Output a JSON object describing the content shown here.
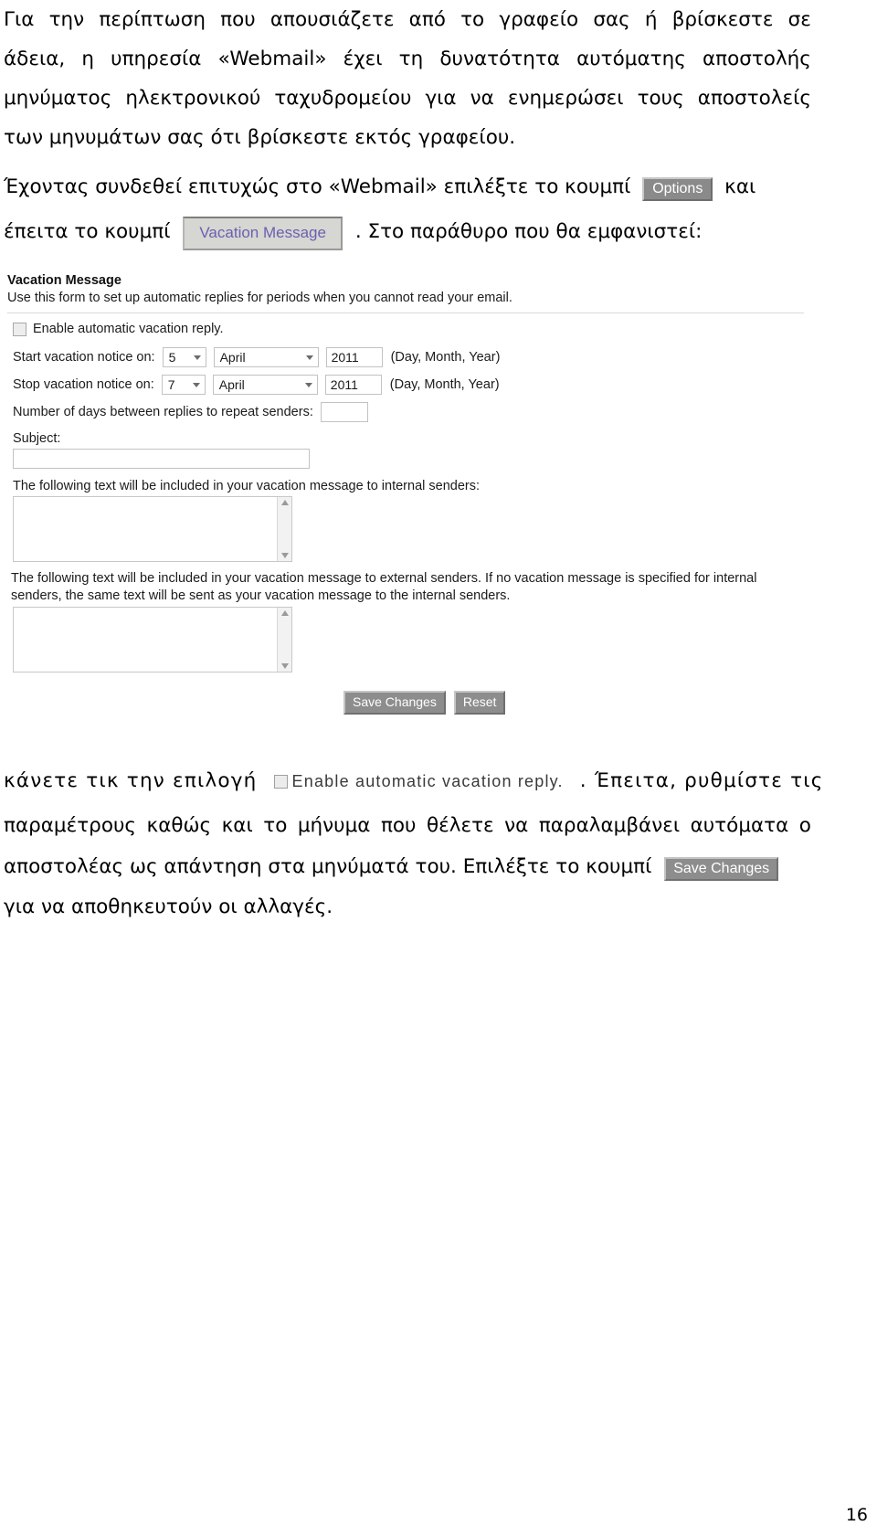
{
  "document": {
    "page_number": "16"
  },
  "intro_paragraph": {
    "lines": [
      [
        "Για",
        "την",
        "περίπτωση",
        "που",
        "απουσιάζετε",
        "από",
        "το",
        "γραφείο",
        "σας",
        "ή",
        "βρίσκεστε",
        "σε"
      ],
      [
        "άδεια,",
        "η",
        "υπηρεσία",
        "«Webmail»",
        "έχει",
        "τη",
        "δυνατότητα",
        "αυτόματης",
        "αποστολής"
      ],
      [
        "μηνύματος",
        "ηλεκτρονικού",
        "ταχυδρομείου",
        "για",
        "να",
        "ενημερώσει",
        "τους",
        "αποστολείς"
      ]
    ],
    "last_line": "των μηνυμάτων σας ότι βρίσκεστε εκτός γραφείου."
  },
  "instruction_paragraph": {
    "line1_before": "Έχοντας συνδεθεί επιτυχώς στο «Webmail» επιλέξτε το κουμπί",
    "options_button_label": "Options",
    "line1_after": "και",
    "line2_before": "έπειτα το κουμπί",
    "vacation_button_label": "Vacation Message",
    "line2_after": ". Στο παράθυρο που θα εμφανιστεί:"
  },
  "vacation_form": {
    "title": "Vacation Message",
    "description": "Use this form to set up automatic replies for periods when you cannot read your email.",
    "enable_checkbox": {
      "label": "Enable automatic vacation reply.",
      "checked": false
    },
    "start_row": {
      "label": "Start vacation notice on:",
      "day": "5",
      "month": "April",
      "year": "2011",
      "hint": "(Day, Month, Year)"
    },
    "stop_row": {
      "label": "Stop vacation notice on:",
      "day": "7",
      "month": "April",
      "year": "2011",
      "hint": "(Day, Month, Year)"
    },
    "repeat_days": {
      "label": "Number of days between replies to repeat senders:",
      "value": ""
    },
    "subject": {
      "label": "Subject:",
      "value": ""
    },
    "internal_message": {
      "label": "The following text will be included in your vacation message to internal senders:",
      "value": ""
    },
    "external_message": {
      "label": "The following text will be included in your vacation message to external senders. If no vacation message is specified for internal senders, the same text will be sent as your vacation message to the internal senders.",
      "value": ""
    },
    "buttons": {
      "save": "Save Changes",
      "reset": "Reset"
    }
  },
  "closing_paragraph": {
    "line1_before": "κάνετε τικ την επιλογή",
    "enable_inline_label": "Enable automatic vacation reply.",
    "line1_after": ". Έπειτα, ρυθμίστε τις",
    "line2": [
      "παραμέτρους",
      "καθώς",
      "και",
      "το",
      "μήνυμα",
      "που",
      "θέλετε",
      "να",
      "παραλαμβάνει",
      "αυτόματα",
      "ο"
    ],
    "line3_before": "αποστολέας ως απάντηση στα μηνύματά του. Επιλέξτε το κουμπί",
    "save_button_label": "Save Changes",
    "line4": "για να αποθηκευτούν οι αλλαγές."
  },
  "colors": {
    "button_gray": "#8a8a8a",
    "vacation_button_text": "#6c5fb0",
    "vacation_button_bg": "#d6d6d2",
    "form_text": "#1b1b1b",
    "field_border": "#c2c2c2"
  }
}
